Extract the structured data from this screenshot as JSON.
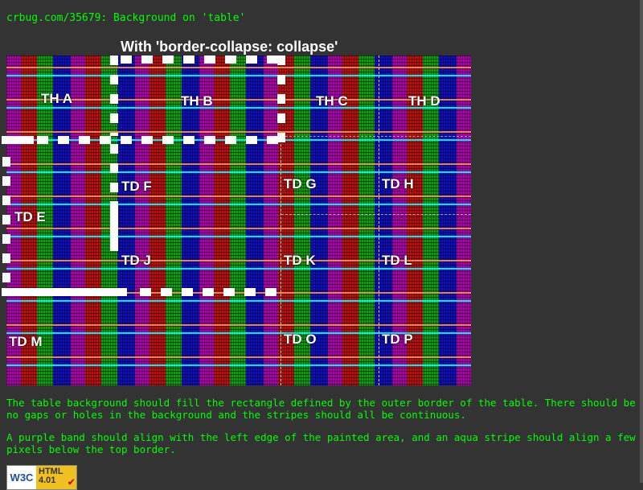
{
  "page": {
    "heading": "crbug.com/35679: Background on 'table'",
    "caption": "With 'border-collapse: collapse'"
  },
  "cells": {
    "th_a": "TH A",
    "th_b": "TH B",
    "th_c": "TH C",
    "th_d": "TH D",
    "td_e": "TD E",
    "td_f": "TD F",
    "td_g": "TD G",
    "td_h": "TD H",
    "td_j": "TD J",
    "td_k": "TD K",
    "td_l": "TD L",
    "td_m": "TD M",
    "td_o": "TD O",
    "td_p": "TD P"
  },
  "notes": {
    "fill": "The table background should fill the rectangle defined by the outer border of the table. There should be no gaps or holes in the background and the stripes should all be continuous.",
    "align": "A purple band should align with the left edge of the painted area, and an aqua stripe should align a few pixels below the top border."
  },
  "badge": {
    "w3c": "W3C",
    "html": "HTML",
    "version": "4.01",
    "check": "✔"
  },
  "colors": {
    "text_green": "#00ff00",
    "background": "#333333",
    "border": "#ffffff",
    "stripe_purple": "#b000b0",
    "stripe_red": "#c01010",
    "stripe_green": "#10a010",
    "stripe_blue": "#1010c0",
    "stripe_aqua": "#00ffff"
  }
}
